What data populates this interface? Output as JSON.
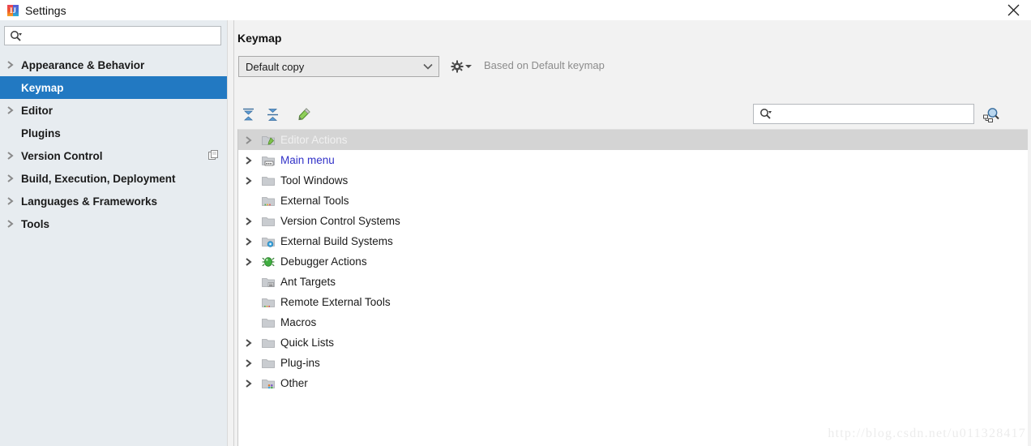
{
  "window": {
    "title": "Settings",
    "app_icon": "intellij-idea-icon",
    "close_label": "×"
  },
  "sidebar": {
    "search": {
      "value": "",
      "placeholder": "",
      "icon": "search-icon"
    },
    "items": [
      {
        "label": "Appearance & Behavior",
        "expandable": true,
        "selected": false,
        "badge": null
      },
      {
        "label": "Keymap",
        "expandable": false,
        "selected": true,
        "badge": null
      },
      {
        "label": "Editor",
        "expandable": true,
        "selected": false,
        "badge": null
      },
      {
        "label": "Plugins",
        "expandable": false,
        "selected": false,
        "badge": null
      },
      {
        "label": "Version Control",
        "expandable": true,
        "selected": false,
        "badge": "copy-icon"
      },
      {
        "label": "Build, Execution, Deployment",
        "expandable": true,
        "selected": false,
        "badge": null
      },
      {
        "label": "Languages & Frameworks",
        "expandable": true,
        "selected": false,
        "badge": null
      },
      {
        "label": "Tools",
        "expandable": true,
        "selected": false,
        "badge": null
      }
    ]
  },
  "main": {
    "title": "Keymap",
    "keymap_select": {
      "value": "Default copy",
      "arrow_icon": "chevron-down-icon"
    },
    "gear": {
      "icon": "gear-icon",
      "arrow_icon": "chevron-down-icon"
    },
    "based_on": "Based on Default keymap",
    "toolbar": {
      "expand_all_label": "expand-all-icon",
      "collapse_all_label": "collapse-all-icon",
      "edit_shortcut_label": "edit-pencil-icon"
    },
    "search": {
      "value": "",
      "placeholder": "",
      "icon": "search-icon"
    },
    "find_by_shortcut": {
      "icon": "find-by-shortcut-icon"
    },
    "tree": [
      {
        "label": "Editor Actions",
        "expandable": true,
        "selected": true,
        "link": false,
        "icon": "folder-edit-icon"
      },
      {
        "label": "Main menu",
        "expandable": true,
        "selected": false,
        "link": true,
        "icon": "folder-menu-icon"
      },
      {
        "label": "Tool Windows",
        "expandable": true,
        "selected": false,
        "link": false,
        "icon": "folder-icon"
      },
      {
        "label": "External Tools",
        "expandable": false,
        "selected": false,
        "link": false,
        "icon": "folder-tools-icon"
      },
      {
        "label": "Version Control Systems",
        "expandable": true,
        "selected": false,
        "link": false,
        "icon": "folder-icon"
      },
      {
        "label": "External Build Systems",
        "expandable": true,
        "selected": false,
        "link": false,
        "icon": "folder-build-icon"
      },
      {
        "label": "Debugger Actions",
        "expandable": true,
        "selected": false,
        "link": false,
        "icon": "bug-icon"
      },
      {
        "label": "Ant Targets",
        "expandable": false,
        "selected": false,
        "link": false,
        "icon": "folder-ant-icon"
      },
      {
        "label": "Remote External Tools",
        "expandable": false,
        "selected": false,
        "link": false,
        "icon": "folder-remote-icon"
      },
      {
        "label": "Macros",
        "expandable": false,
        "selected": false,
        "link": false,
        "icon": "folder-icon"
      },
      {
        "label": "Quick Lists",
        "expandable": true,
        "selected": false,
        "link": false,
        "icon": "folder-icon"
      },
      {
        "label": "Plug-ins",
        "expandable": true,
        "selected": false,
        "link": false,
        "icon": "folder-icon"
      },
      {
        "label": "Other",
        "expandable": true,
        "selected": false,
        "link": false,
        "icon": "folder-other-icon"
      }
    ]
  },
  "watermark": {
    "text": "http://blog.csdn.net/u011328417"
  },
  "colors": {
    "selection_blue": "#2279c2",
    "tree_selection_gray": "#d4d4d4",
    "sidebar_bg": "#e7ecf0",
    "panel_bg": "#f2f2f2",
    "link_blue": "#3232c8",
    "muted_text": "#8c8c8c"
  }
}
